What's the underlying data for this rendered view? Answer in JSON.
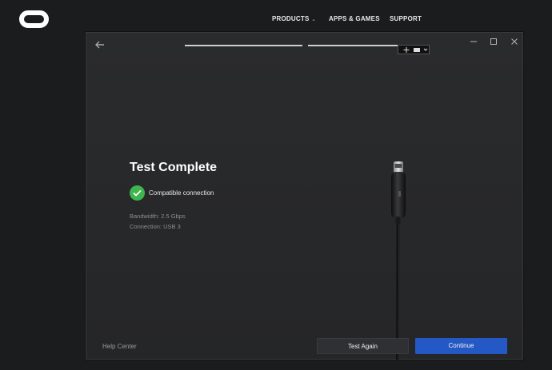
{
  "site": {
    "nav": {
      "products": "PRODUCTS",
      "apps_games": "APPS & GAMES",
      "support": "SUPPORT"
    }
  },
  "window": {
    "title": "Test Complete",
    "status": "Compatible connection",
    "bandwidth": "Bandwidth: 2.5 Gbps",
    "connection": "Connection: USB 3",
    "help_link": "Help Center",
    "test_again": "Test Again",
    "continue": "Continue"
  },
  "colors": {
    "accent": "#2458c4",
    "success": "#3fb54d"
  }
}
